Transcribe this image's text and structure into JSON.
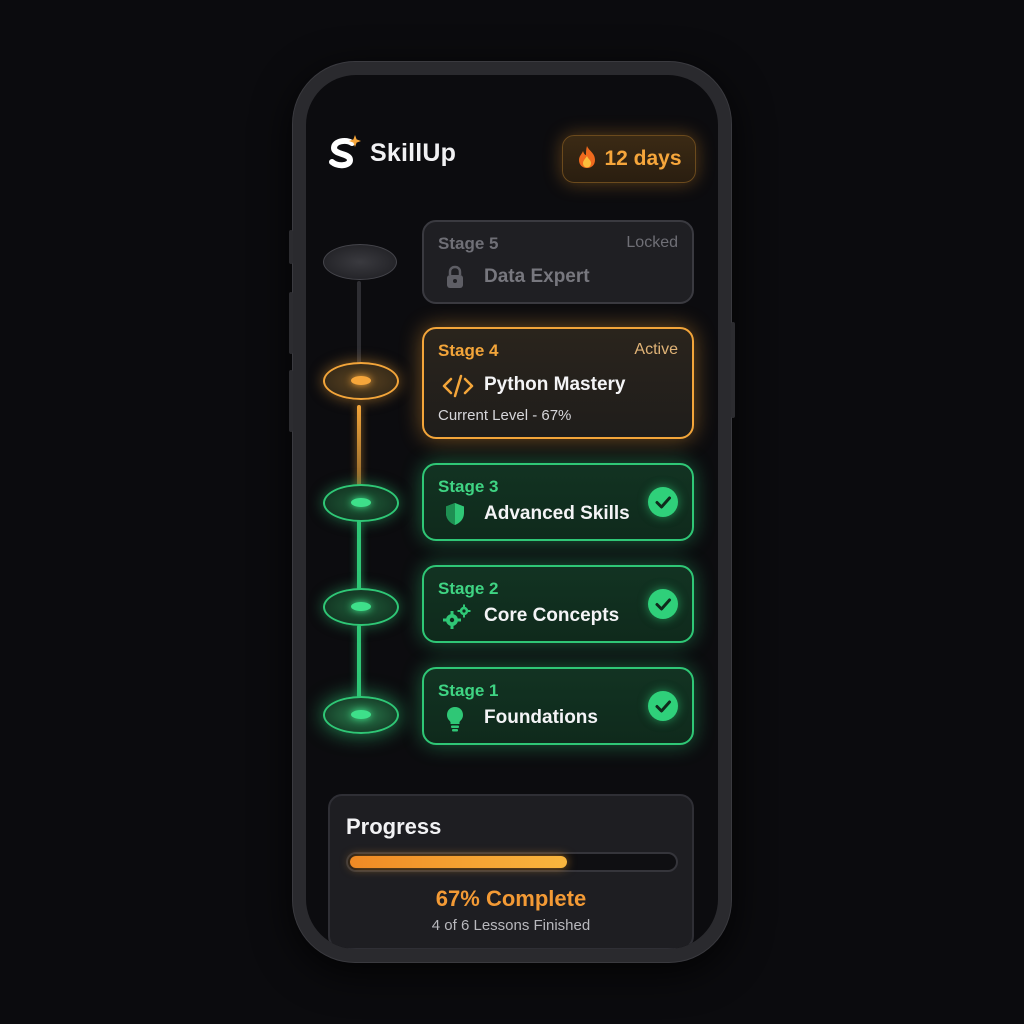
{
  "app": {
    "name": "SkillUp"
  },
  "streak": {
    "icon": "fire-icon",
    "label": "12 days",
    "color": "#f6a63b"
  },
  "stages": [
    {
      "label": "Stage 5",
      "status": "Locked",
      "title": "Data Expert",
      "icon": "lock-icon",
      "state": "locked"
    },
    {
      "label": "Stage 4",
      "status": "Active",
      "title": "Python Mastery",
      "subtitle": "Current Level - 67%",
      "icon": "code-icon",
      "state": "active"
    },
    {
      "label": "Stage 3",
      "title": "Advanced Skills",
      "icon": "shield-icon",
      "state": "done"
    },
    {
      "label": "Stage 2",
      "title": "Core Concepts",
      "icon": "gears-icon",
      "state": "done"
    },
    {
      "label": "Stage 1",
      "title": "Foundations",
      "icon": "lightbulb-icon",
      "state": "done"
    }
  ],
  "progress": {
    "title": "Progress",
    "fraction": 0.67,
    "percent_label": "67% Complete",
    "detail": "4 of 6 Lessons Finished"
  },
  "colors": {
    "active": "#f3a53a",
    "done": "#2fc776",
    "locked": "#3a3a40",
    "background": "#0c0c0f"
  }
}
